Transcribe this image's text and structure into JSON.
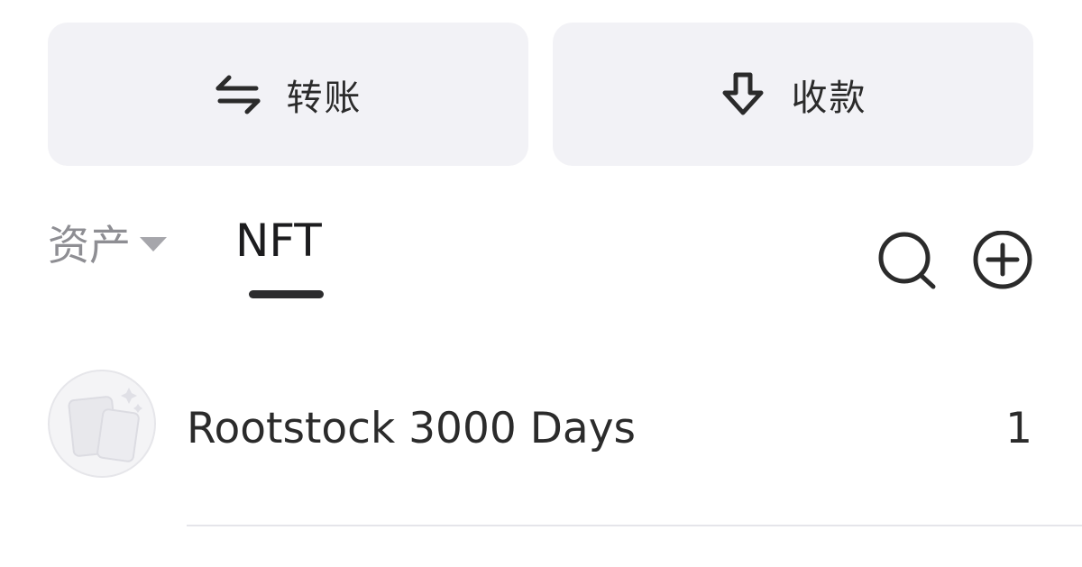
{
  "actions": {
    "transfer": {
      "label": "转账",
      "icon": "swap-arrows-icon"
    },
    "receive": {
      "label": "收款",
      "icon": "download-arrow-icon"
    }
  },
  "tabs": {
    "assets": {
      "label": "资产",
      "icon": "caret-down-icon"
    },
    "nft": {
      "label": "NFT",
      "active": true
    }
  },
  "toolbar": {
    "search_icon": "search-icon",
    "add_icon": "add-circle-icon"
  },
  "nft_list": [
    {
      "name": "Rootstock 3000 Days",
      "count": "1",
      "thumbnail_icon": "nft-placeholder-icon"
    }
  ],
  "colors": {
    "button_bg": "#f2f2f6",
    "text_primary": "#2b2b2b",
    "text_secondary": "#8e8e93",
    "indicator": "#2c2c2e"
  }
}
